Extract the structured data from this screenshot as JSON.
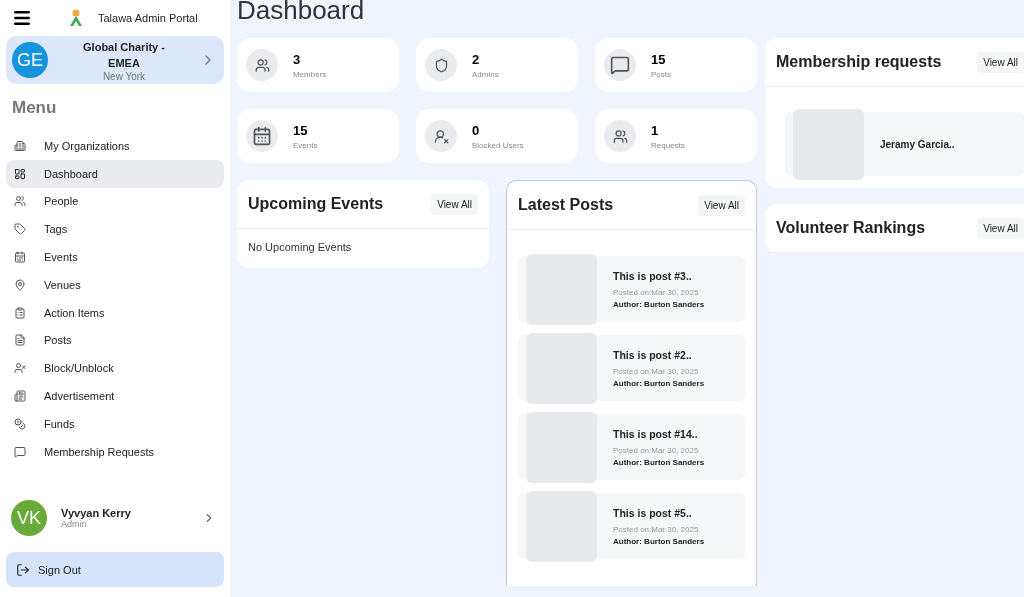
{
  "sidebar": {
    "app_title": "Talawa Admin Portal",
    "organization": {
      "initials": "GE",
      "name": "Global Charity - EMEA",
      "location": "New York"
    },
    "menu_heading": "Menu",
    "items": [
      {
        "label": "My Organizations",
        "selected": false
      },
      {
        "label": "Dashboard",
        "selected": true
      },
      {
        "label": "People",
        "selected": false
      },
      {
        "label": "Tags",
        "selected": false
      },
      {
        "label": "Events",
        "selected": false
      },
      {
        "label": "Venues",
        "selected": false
      },
      {
        "label": "Action Items",
        "selected": false
      },
      {
        "label": "Posts",
        "selected": false
      },
      {
        "label": "Block/Unblock",
        "selected": false
      },
      {
        "label": "Advertisement",
        "selected": false
      },
      {
        "label": "Funds",
        "selected": false
      },
      {
        "label": "Membership Requests",
        "selected": false
      }
    ],
    "user": {
      "initials": "VK",
      "name": "Vyvyan Kerry",
      "role": "Admin"
    },
    "sign_out": "Sign Out"
  },
  "page_title": "Dashboard",
  "stats": [
    {
      "kind": "members",
      "value": "3",
      "label": "Members"
    },
    {
      "kind": "admins",
      "value": "2",
      "label": "Admins"
    },
    {
      "kind": "posts",
      "value": "15",
      "label": "Posts"
    },
    {
      "kind": "events",
      "value": "15",
      "label": "Events"
    },
    {
      "kind": "blocked",
      "value": "0",
      "label": "Blocked Users"
    },
    {
      "kind": "requests",
      "value": "1",
      "label": "Requests"
    }
  ],
  "upcoming_events": {
    "title": "Upcoming Events",
    "button": "View All",
    "empty_text": "No Upcoming Events"
  },
  "latest_posts": {
    "title": "Latest Posts",
    "button": "View All",
    "posts": [
      {
        "title": "This is post #3..",
        "posted": "Posted on:Mar 30, 2025",
        "author": "Author: Burton Sanders"
      },
      {
        "title": "This is post #2..",
        "posted": "Posted on:Mar 30, 2025",
        "author": "Author: Burton Sanders"
      },
      {
        "title": "This is post #14..",
        "posted": "Posted on:Mar 30, 2025",
        "author": "Author: Burton Sanders"
      },
      {
        "title": "This is post #5..",
        "posted": "Posted on:Mar 30, 2025",
        "author": "Author: Burton Sanders"
      }
    ]
  },
  "membership_requests": {
    "title": "Membership requests",
    "button": "View All",
    "requests": [
      {
        "name": "Jeramy Garcia.."
      }
    ]
  },
  "volunteer_rankings": {
    "title": "Volunteer Rankings",
    "button": "View All"
  }
}
